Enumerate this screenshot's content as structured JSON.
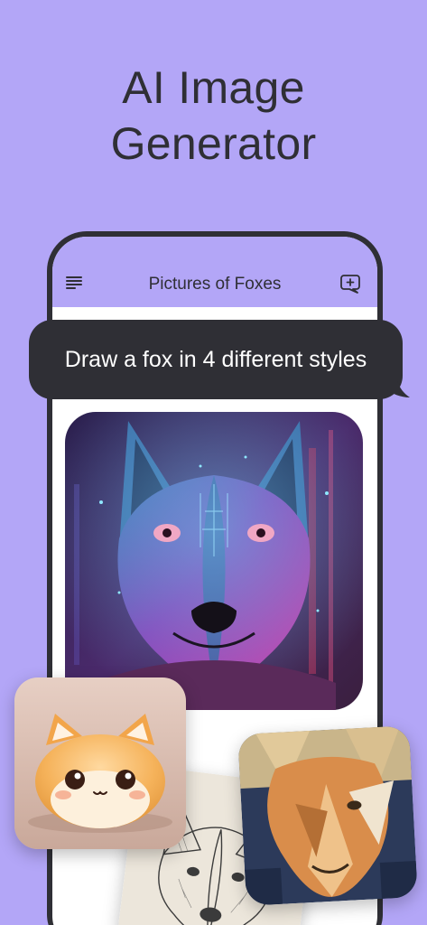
{
  "headline": {
    "line1": "AI Image",
    "line2": "Generator"
  },
  "app": {
    "title": "Pictures of Foxes",
    "menu_icon": "menu-icon",
    "new_chat_icon": "new-chat-icon"
  },
  "prompt": {
    "text": "Draw a fox in 4 different styles"
  },
  "images": [
    {
      "style": "cyberpunk neon fox"
    },
    {
      "style": "cute 3D fox"
    },
    {
      "style": "pencil sketch fox"
    },
    {
      "style": "geometric painting fox"
    }
  ],
  "colors": {
    "background": "#b3a6f7",
    "dark": "#2f2f35",
    "white": "#ffffff"
  }
}
